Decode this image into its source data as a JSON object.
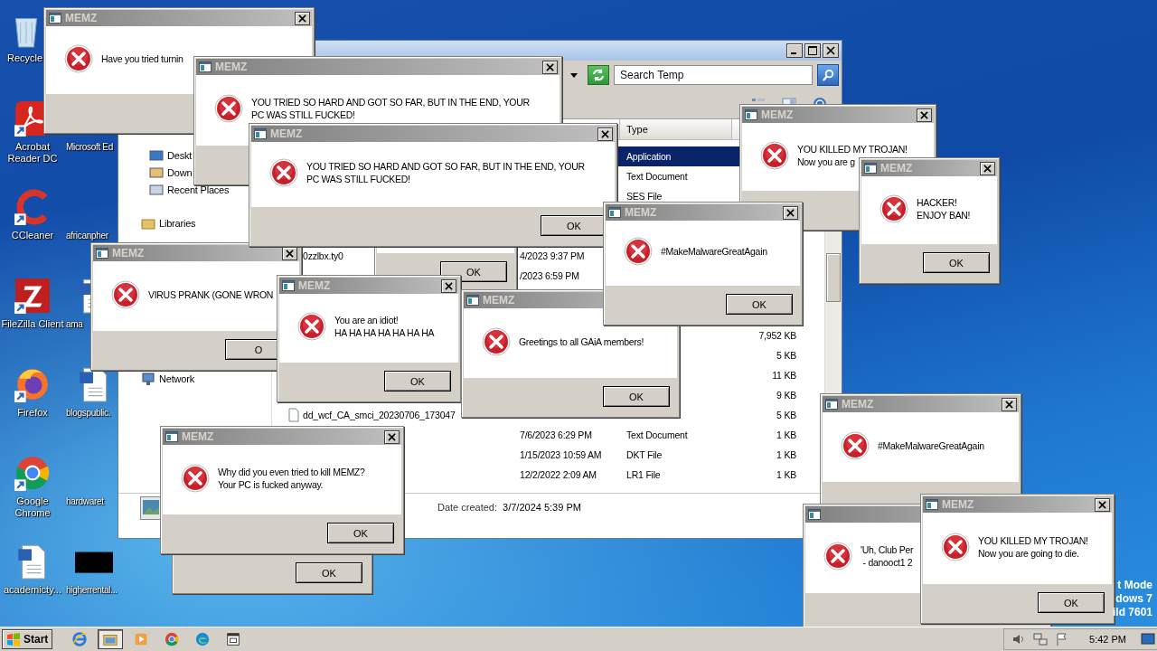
{
  "desktop_icons": {
    "column_1": [
      {
        "label": "Recycle",
        "kind": "recycle"
      },
      {
        "label": "Acrobat Reader DC",
        "kind": "acrobat"
      },
      {
        "label": "CCleaner",
        "kind": "ccleaner"
      },
      {
        "label": "FileZilla Client",
        "kind": "filezilla"
      },
      {
        "label": "Firefox",
        "kind": "firefox"
      },
      {
        "label": "Google Chrome",
        "kind": "chrome"
      },
      {
        "label": "academicty...",
        "kind": "word"
      }
    ],
    "column_2": [
      {
        "label": "Microsoft Ed"
      },
      {
        "label": "africanpher"
      },
      {
        "label": "ama",
        "kind": "word"
      },
      {
        "label": "blogspublic.",
        "kind": "word"
      },
      {
        "label": "hardwaret"
      },
      {
        "label": "higherrental...",
        "kind": "thumb"
      }
    ]
  },
  "explorer": {
    "search": {
      "placeholder": "Search Temp"
    },
    "favorites_items": [
      {
        "label": "Deskt",
        "kind": "desktop"
      },
      {
        "label": "Down",
        "kind": "downloads"
      },
      {
        "label": "Recent Places",
        "kind": "recent"
      }
    ],
    "sidebar": [
      {
        "label": "Libraries",
        "kind": "libraries"
      },
      {
        "label": "Network",
        "kind": "network"
      }
    ],
    "columns": [
      {
        "label": "Type"
      }
    ],
    "rows": [
      {
        "type": "Application",
        "selected": true
      },
      {
        "type": "Text Document",
        "selected": false
      },
      {
        "type": "SES File",
        "selected": false
      },
      {
        "name": "0zzlbx.ty0",
        "date": "4/2023 9:37 PM",
        "selected": false
      },
      {
        "date": "/2023 6:59 PM",
        "selected": false
      },
      {
        "size": "7,952 KB",
        "selected": false
      },
      {
        "size": "5 KB",
        "selected": false
      },
      {
        "size": "11 KB",
        "selected": false
      },
      {
        "size": "9 KB",
        "selected": false
      },
      {
        "name": "dd_wcf_CA_smci_20230706_173047",
        "size": "5 KB",
        "selected": false
      },
      {
        "date": "7/6/2023 6:29 PM",
        "type": "Text Document",
        "size": "1 KB",
        "selected": false
      },
      {
        "date": "1/15/2023 10:59 AM",
        "type": "DKT File",
        "size": "1 KB",
        "selected": false
      },
      {
        "date": "12/2/2022 2:09 AM",
        "type": "LR1 File",
        "size": "1 KB",
        "selected": false
      }
    ],
    "details": {
      "label": "Date created:",
      "value": "3/7/2024 5:39 PM"
    }
  },
  "dialogs": [
    {
      "title": "MEMZ",
      "lines": [
        "Have you tried turnin"
      ]
    },
    {
      "title": "MEMZ",
      "lines": [
        "YOU TRIED SO HARD AND GOT SO FAR, BUT IN THE END, YOUR",
        "PC WAS STILL FUCKED!"
      ]
    },
    {
      "title": "MEMZ",
      "lines": [
        "VIRUS PRANK (GONE WRON"
      ],
      "ok": "O"
    },
    {
      "ok": "OK"
    },
    {
      "title": "MEMZ",
      "lines": [
        "YOU TRIED SO HARD AND GOT SO FAR, BUT IN THE END, YOUR",
        "PC WAS STILL FUCKED!"
      ],
      "ok": "OK"
    },
    {
      "title": "MEMZ",
      "lines": [
        "YOU KILLED MY TROJAN!",
        "Now you are g"
      ]
    },
    {
      "title": "MEMZ",
      "lines": [
        "You are an idiot!",
        "HA HA HA HA HA HA HA"
      ],
      "ok": "OK"
    },
    {
      "title": "MEMZ",
      "lines": [
        "Greetings to all GAiA members!"
      ],
      "ok": "OK"
    },
    {
      "title": "MEMZ",
      "lines": [
        "#MakeMalwareGreatAgain"
      ],
      "ok": "OK"
    },
    {
      "title": "MEMZ",
      "lines": [
        "HACKER!",
        "ENJOY BAN!"
      ],
      "ok": "OK"
    },
    {
      "ok": "OK"
    },
    {
      "title": "MEMZ",
      "lines": [
        "Why did you even tried to kill MEMZ?",
        "Your PC is fucked anyway."
      ],
      "ok": "OK"
    },
    {
      "title": "MEMZ",
      "lines": [
        "#MakeMalwareGreatAgain"
      ]
    },
    {
      "lines": [
        "'Uh, Club Per",
        " - danooct1 2"
      ]
    },
    {
      "title": "MEMZ",
      "lines": [
        "YOU KILLED MY TROJAN!",
        "Now you are going to die."
      ],
      "ok": "OK"
    }
  ],
  "desktop_notice": "t Mode\ndows 7\nild 7601",
  "taskbar": {
    "start": "Start",
    "apps": [
      {
        "kind": "ie",
        "selected": false
      },
      {
        "kind": "explorer",
        "selected": true
      },
      {
        "kind": "media",
        "selected": false
      },
      {
        "kind": "chrome",
        "selected": false
      },
      {
        "kind": "edge",
        "selected": false
      },
      {
        "kind": "app",
        "selected": false
      }
    ],
    "clock": "5:42 PM"
  }
}
